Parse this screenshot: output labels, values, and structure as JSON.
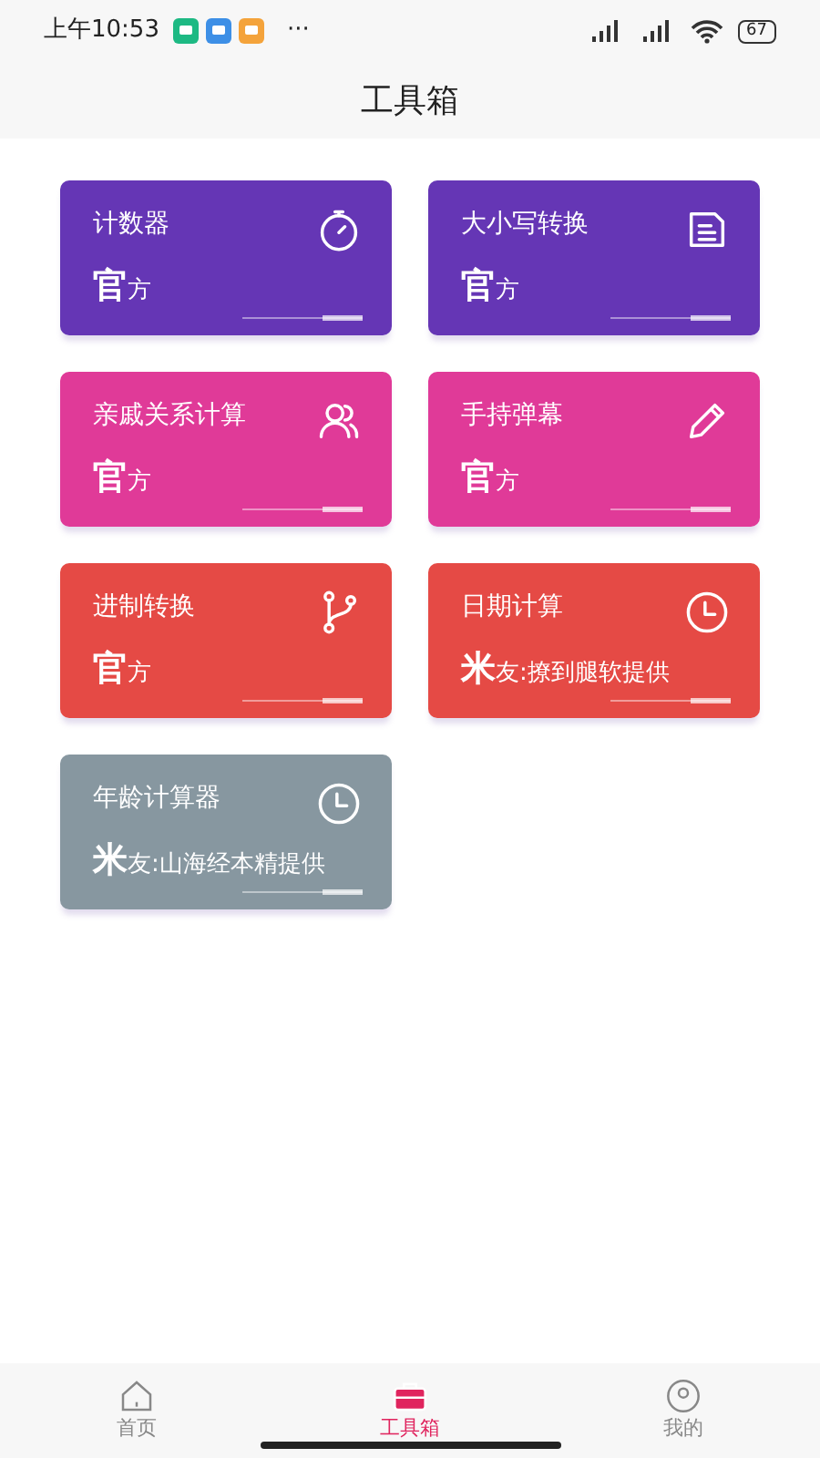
{
  "status_bar": {
    "time": "上午10:53",
    "more": "···",
    "battery": "67"
  },
  "header": {
    "title": "工具箱"
  },
  "tools": [
    {
      "name": "计数器",
      "provider": "官方",
      "kind": "stopwatch",
      "color": "#6536b5"
    },
    {
      "name": "大小写转换",
      "provider": "官方",
      "kind": "document",
      "color": "#6536b5"
    },
    {
      "name": "亲戚关系计算",
      "provider": "官方",
      "kind": "people",
      "color": "#e03a98"
    },
    {
      "name": "手持弹幕",
      "provider": "官方",
      "kind": "pencil",
      "color": "#e03a98"
    },
    {
      "name": "进制转换",
      "provider": "官方",
      "kind": "branch",
      "color": "#e54a45"
    },
    {
      "name": "日期计算",
      "provider": "米友:撩到腿软提供",
      "kind": "clock",
      "color": "#e54a45"
    },
    {
      "name": "年龄计算器",
      "provider": "米友:山海经本精提供",
      "kind": "clock",
      "color": "#8797a0"
    }
  ],
  "tab_bar": [
    {
      "label": "首页",
      "kind": "home",
      "selected": false
    },
    {
      "label": "工具箱",
      "kind": "toolbox",
      "selected": true
    },
    {
      "label": "我的",
      "kind": "person",
      "selected": false
    }
  ]
}
